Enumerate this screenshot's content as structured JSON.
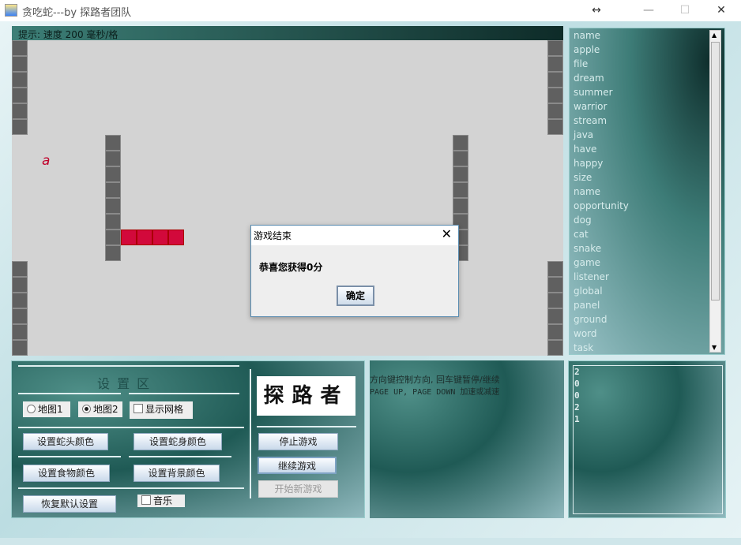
{
  "window": {
    "title": "贪吃蛇---by 探路者团队",
    "resize_icon": "↔",
    "minimize": "—",
    "maximize": "☐",
    "close": "✕"
  },
  "hint": "提示: 速度 200 毫秒/格",
  "board": {
    "food": "a",
    "colors": {
      "wall": "#606060",
      "snake": "#d2093b",
      "background": "#d3d3d3",
      "food": "#c0002a"
    }
  },
  "words": [
    "name",
    "apple",
    "file",
    "dream",
    "summer",
    "warrior",
    "stream",
    "java",
    "have",
    "happy",
    "size",
    "name",
    "opportunity",
    "dog",
    "cat",
    "snake",
    "game",
    "listener",
    "global",
    "panel",
    "ground",
    "word",
    "task"
  ],
  "settings": {
    "title": "设 置 区",
    "map1": "地图1",
    "map2": "地图2",
    "map_selected": "地图2",
    "show_grid": "显示网格",
    "show_grid_checked": false,
    "snake_head_color": "设置蛇头颜色",
    "snake_body_color": "设置蛇身颜色",
    "food_color": "设置食物颜色",
    "background_color": "设置背景颜色",
    "restore_default": "恢复默认设置",
    "music": "音乐",
    "music_checked": false
  },
  "logo": "探路者",
  "controls": {
    "stop": "停止游戏",
    "continue": "继续游戏",
    "new_game": "开始新游戏"
  },
  "help": {
    "line1": "方向键控制方向, 回车键暂停/继续",
    "line2": "PAGE UP, PAGE DOWN 加速或减速"
  },
  "score_digits": [
    "2",
    "0",
    "0",
    "2",
    "1"
  ],
  "dialog": {
    "title": "游戏结束",
    "message": "恭喜您获得0分",
    "ok": "确定",
    "close": "✕"
  }
}
